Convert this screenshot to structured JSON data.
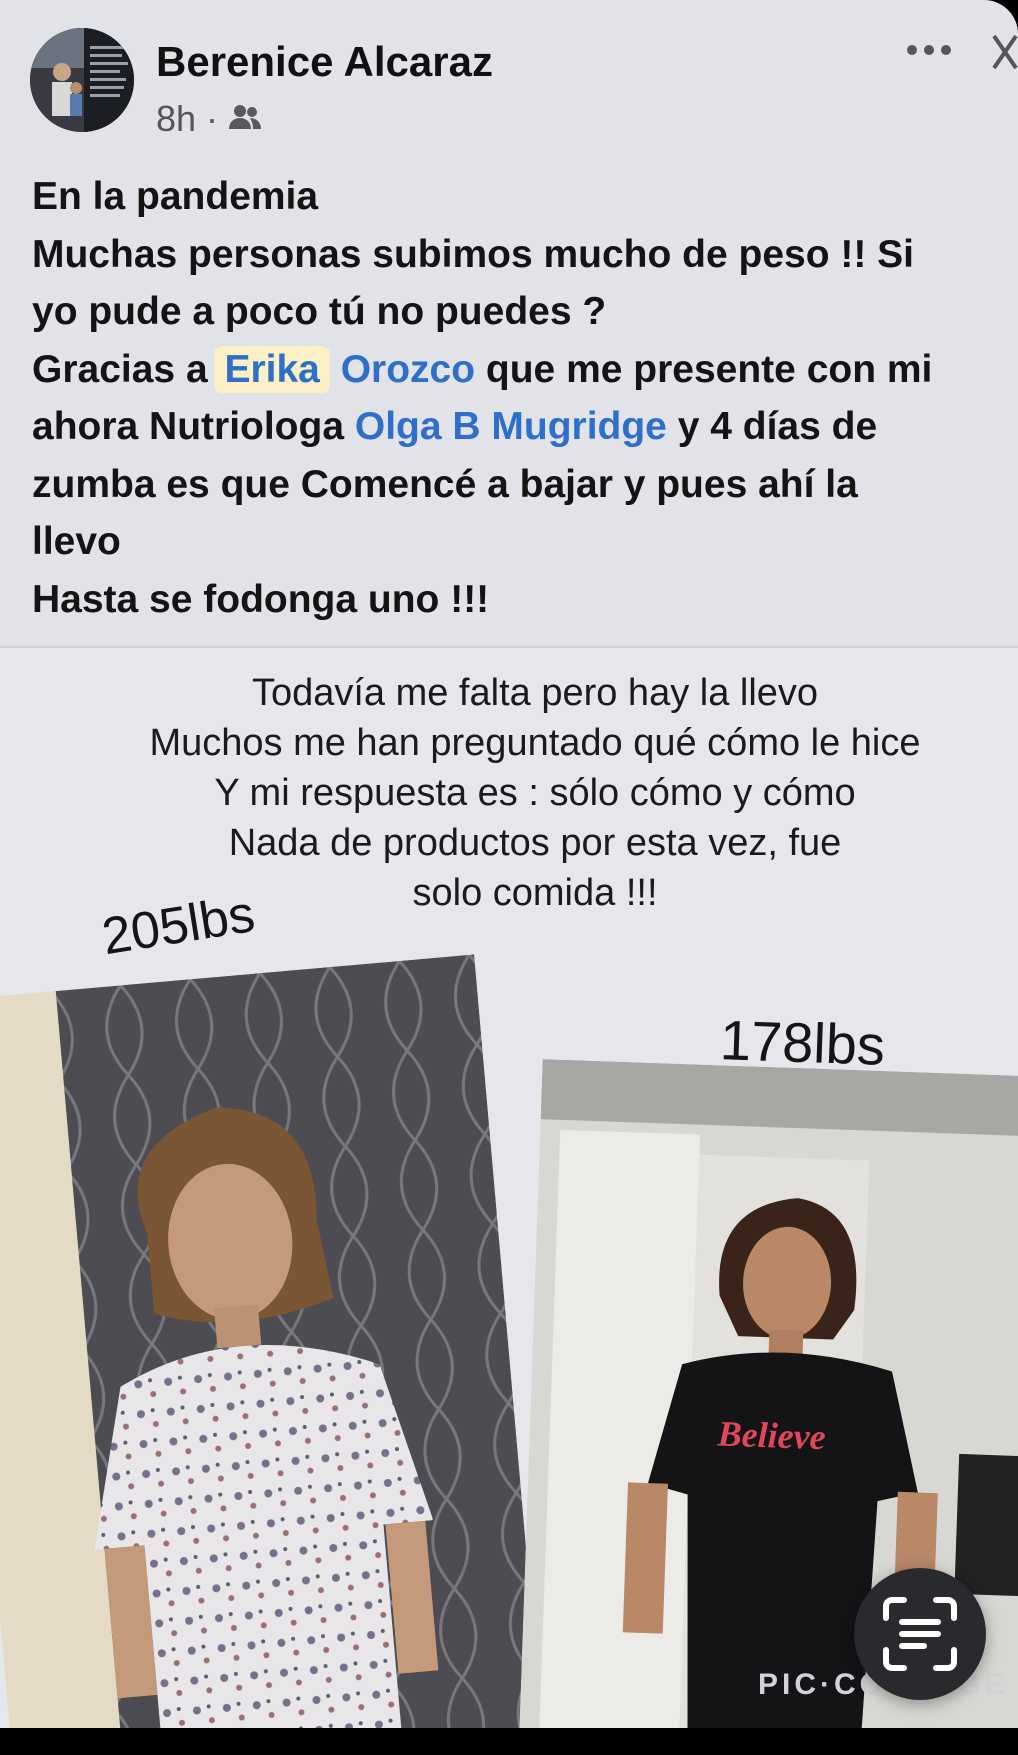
{
  "post": {
    "author": "Berenice Alcaraz",
    "time": "8h",
    "separator": "·",
    "audience_icon": "friends-icon",
    "more_icon": "more-icon",
    "close_icon": "close-icon",
    "lines": [
      "En la pandemia",
      "Muchas personas subimos mucho de peso !! Si",
      "yo pude a poco tú no puedes ?"
    ],
    "line4": {
      "pre": "Gracias a ",
      "m1": "Erika",
      "sp": " ",
      "m2": "Orozco",
      "post": " que me presente con mi"
    },
    "line5": {
      "pre": "ahora Nutriologa ",
      "m": "Olga B Mugridge",
      "post": "  y 4 días de"
    },
    "lines_end": [
      "zumba es que   Comencé a bajar y pues ahí la",
      "llevo",
      "Hasta se fodonga uno !!!"
    ]
  },
  "image": {
    "caption": [
      "Todavía me falta pero hay la llevo",
      "Muchos me han preguntado qué cómo le hice",
      "Y mi respuesta es : sólo cómo y cómo",
      "Nada de productos por esta vez,  fue",
      "solo comida !!!"
    ],
    "before_label": "205lbs",
    "after_label": "178lbs",
    "shirt_text": "Believe",
    "watermark": "PIC·COLLAGE"
  },
  "scan_button_icon": "text-scan-icon",
  "colors": {
    "mention": "#2d6fc9",
    "highlight": "#fbf0c6",
    "card_bg": "#e2e3e8"
  }
}
